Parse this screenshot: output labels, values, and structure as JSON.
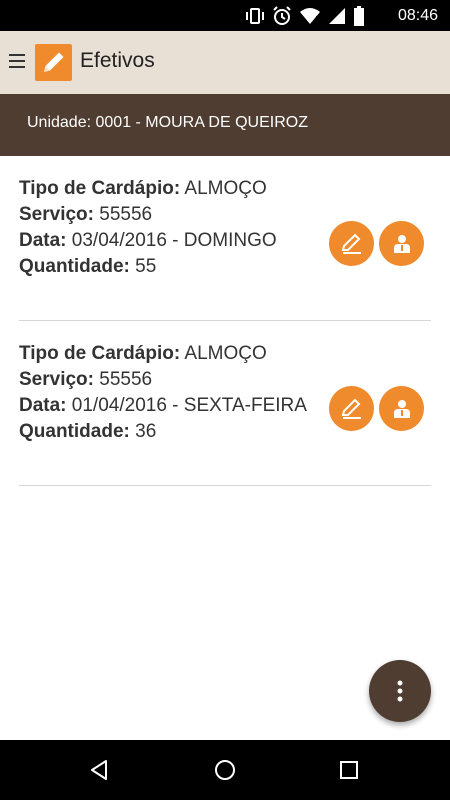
{
  "status_bar": {
    "time": "08:46",
    "icons": [
      "vibrate-icon",
      "alarm-icon",
      "wifi-icon",
      "signal-icon",
      "battery-icon"
    ]
  },
  "app_bar": {
    "title": "Efetivos",
    "menu_icon": "hamburger-icon",
    "logo_icon": "pencil-icon"
  },
  "unit_bar": {
    "text": "Unidade: 0001 - MOURA DE QUEIROZ"
  },
  "labels": {
    "tipo": "Tipo de Cardápio:",
    "servico": "Serviço:",
    "data": "Data:",
    "quantidade": "Quantidade:"
  },
  "items": [
    {
      "tipo": "ALMOÇO",
      "servico": "55556",
      "data": "03/04/2016 - DOMINGO",
      "quantidade": "55"
    },
    {
      "tipo": "ALMOÇO",
      "servico": "55556",
      "data": "01/04/2016 - SEXTA-FEIRA",
      "quantidade": "36"
    }
  ],
  "fab": {
    "icon": "more-vertical-icon"
  },
  "nav_bar": {
    "icons": [
      "back-icon",
      "home-icon",
      "recents-icon"
    ]
  },
  "colors": {
    "accent": "#ef8b2c",
    "primary_dark": "#4e3d30",
    "app_bar": "#e8e0d5"
  }
}
